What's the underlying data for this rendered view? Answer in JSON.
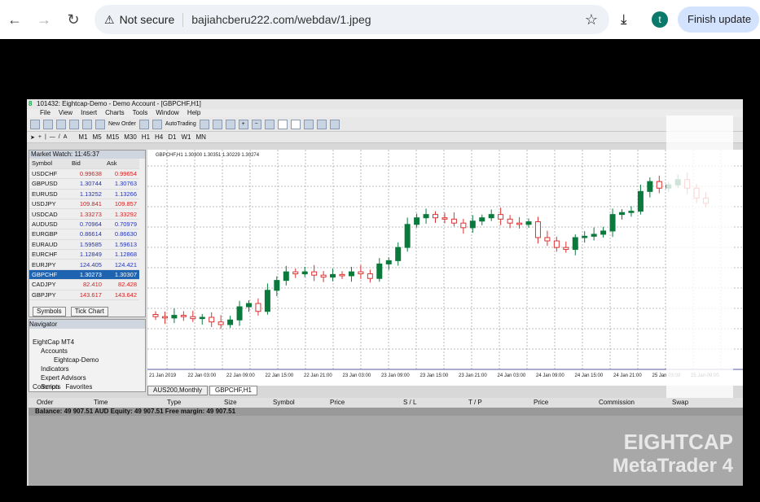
{
  "browser": {
    "security": "Not secure",
    "url": "bajiahcberu222.com/webdav/1.jpeg",
    "avatar": "t",
    "update": "Finish update"
  },
  "app": {
    "title": "101432: Eightcap-Demo - Demo Account - [GBPCHF,H1]",
    "menu": [
      "File",
      "View",
      "Insert",
      "Charts",
      "Tools",
      "Window",
      "Help"
    ],
    "toolbar": {
      "new_order": "New Order",
      "autotrading": "AutoTrading"
    },
    "timeframes": [
      "M1",
      "M5",
      "M15",
      "M30",
      "H1",
      "H4",
      "D1",
      "W1",
      "MN"
    ]
  },
  "market_watch": {
    "title": "Market Watch: 11:45:37",
    "headers": [
      "Symbol",
      "Bid",
      "Ask"
    ],
    "rows": [
      [
        "USDCHF",
        "0.99638",
        "0.99654",
        "dn"
      ],
      [
        "GBPUSD",
        "1.30744",
        "1.30763",
        "up"
      ],
      [
        "EURUSD",
        "1.13252",
        "1.13266",
        "up"
      ],
      [
        "USDJPY",
        "109.841",
        "109.857",
        "dn"
      ],
      [
        "USDCAD",
        "1.33273",
        "1.33292",
        "dn"
      ],
      [
        "AUDUSD",
        "0.70964",
        "0.70979",
        "up"
      ],
      [
        "EURGBP",
        "0.86614",
        "0.86630",
        "up"
      ],
      [
        "EURAUD",
        "1.59585",
        "1.59613",
        "up"
      ],
      [
        "EURCHF",
        "1.12849",
        "1.12868",
        "up"
      ],
      [
        "EURJPY",
        "124.405",
        "124.421",
        "up"
      ],
      [
        "GBPCHF",
        "1.30273",
        "1.30307",
        "sel"
      ],
      [
        "CADJPY",
        "82.410",
        "82.428",
        "dn"
      ],
      [
        "GBPJPY",
        "143.617",
        "143.642",
        "dn"
      ]
    ],
    "tabs": [
      "Symbols",
      "Tick Chart"
    ]
  },
  "navigator": {
    "title": "Navigator",
    "items": [
      "EightCap MT4",
      "Accounts",
      "Eightcap-Demo",
      "Indicators",
      "Expert Advisors",
      "Scripts"
    ],
    "tabs": [
      "Common",
      "Favorites"
    ]
  },
  "chart": {
    "header": "GBPCHF,H1  1.30300 1.30351 1.30229 1.30274",
    "x_labels": [
      "21 Jan 2019",
      "22 Jan 03:00",
      "22 Jan 09:00",
      "22 Jan 15:00",
      "22 Jan 21:00",
      "23 Jan 03:00",
      "23 Jan 09:00",
      "23 Jan 15:00",
      "23 Jan 21:00",
      "24 Jan 03:00",
      "24 Jan 09:00",
      "24 Jan 15:00",
      "24 Jan 21:00",
      "25 Jan 03:00",
      "25 Jan 09:00"
    ],
    "ylim": [
      1.287,
      1.307
    ],
    "closes": [
      1.2918,
      1.29168,
      1.29192,
      1.2918,
      1.29162,
      1.29174,
      1.29132,
      1.29108,
      1.2915,
      1.2927,
      1.293,
      1.29228,
      1.2942,
      1.2951,
      1.29588,
      1.2957,
      1.29588,
      1.29558,
      1.2954,
      1.29564,
      1.29552,
      1.29588,
      1.2957,
      1.29528,
      1.2966,
      1.2969,
      1.2981,
      1.3002,
      1.3008,
      1.3011,
      1.3008,
      1.30068,
      1.30032,
      1.2999,
      1.3005,
      1.3008,
      1.3011,
      1.30068,
      1.30032,
      1.3002,
      1.30044,
      1.299,
      1.2987,
      1.2981,
      1.29792,
      1.299,
      1.29912,
      1.2993,
      1.2996,
      1.3011,
      1.30128,
      1.3014,
      1.3032,
      1.3041,
      1.3035,
      1.3038,
      1.30428,
      1.3035,
      1.3026,
      1.30212
    ],
    "tabs": [
      "AUS200,Monthly",
      "GBPCHF,H1"
    ]
  },
  "terminal": {
    "headers": [
      "Order",
      "Time",
      "Type",
      "Size",
      "Symbol",
      "Price",
      "S / L",
      "T / P",
      "Price",
      "Commission",
      "Swap"
    ],
    "balance": "Balance: 49 907.51 AUD  Equity: 49 907.51  Free margin: 49 907.51"
  },
  "logo": {
    "line1": "EIGHTCAP",
    "line2": "MetaTrader 4"
  }
}
